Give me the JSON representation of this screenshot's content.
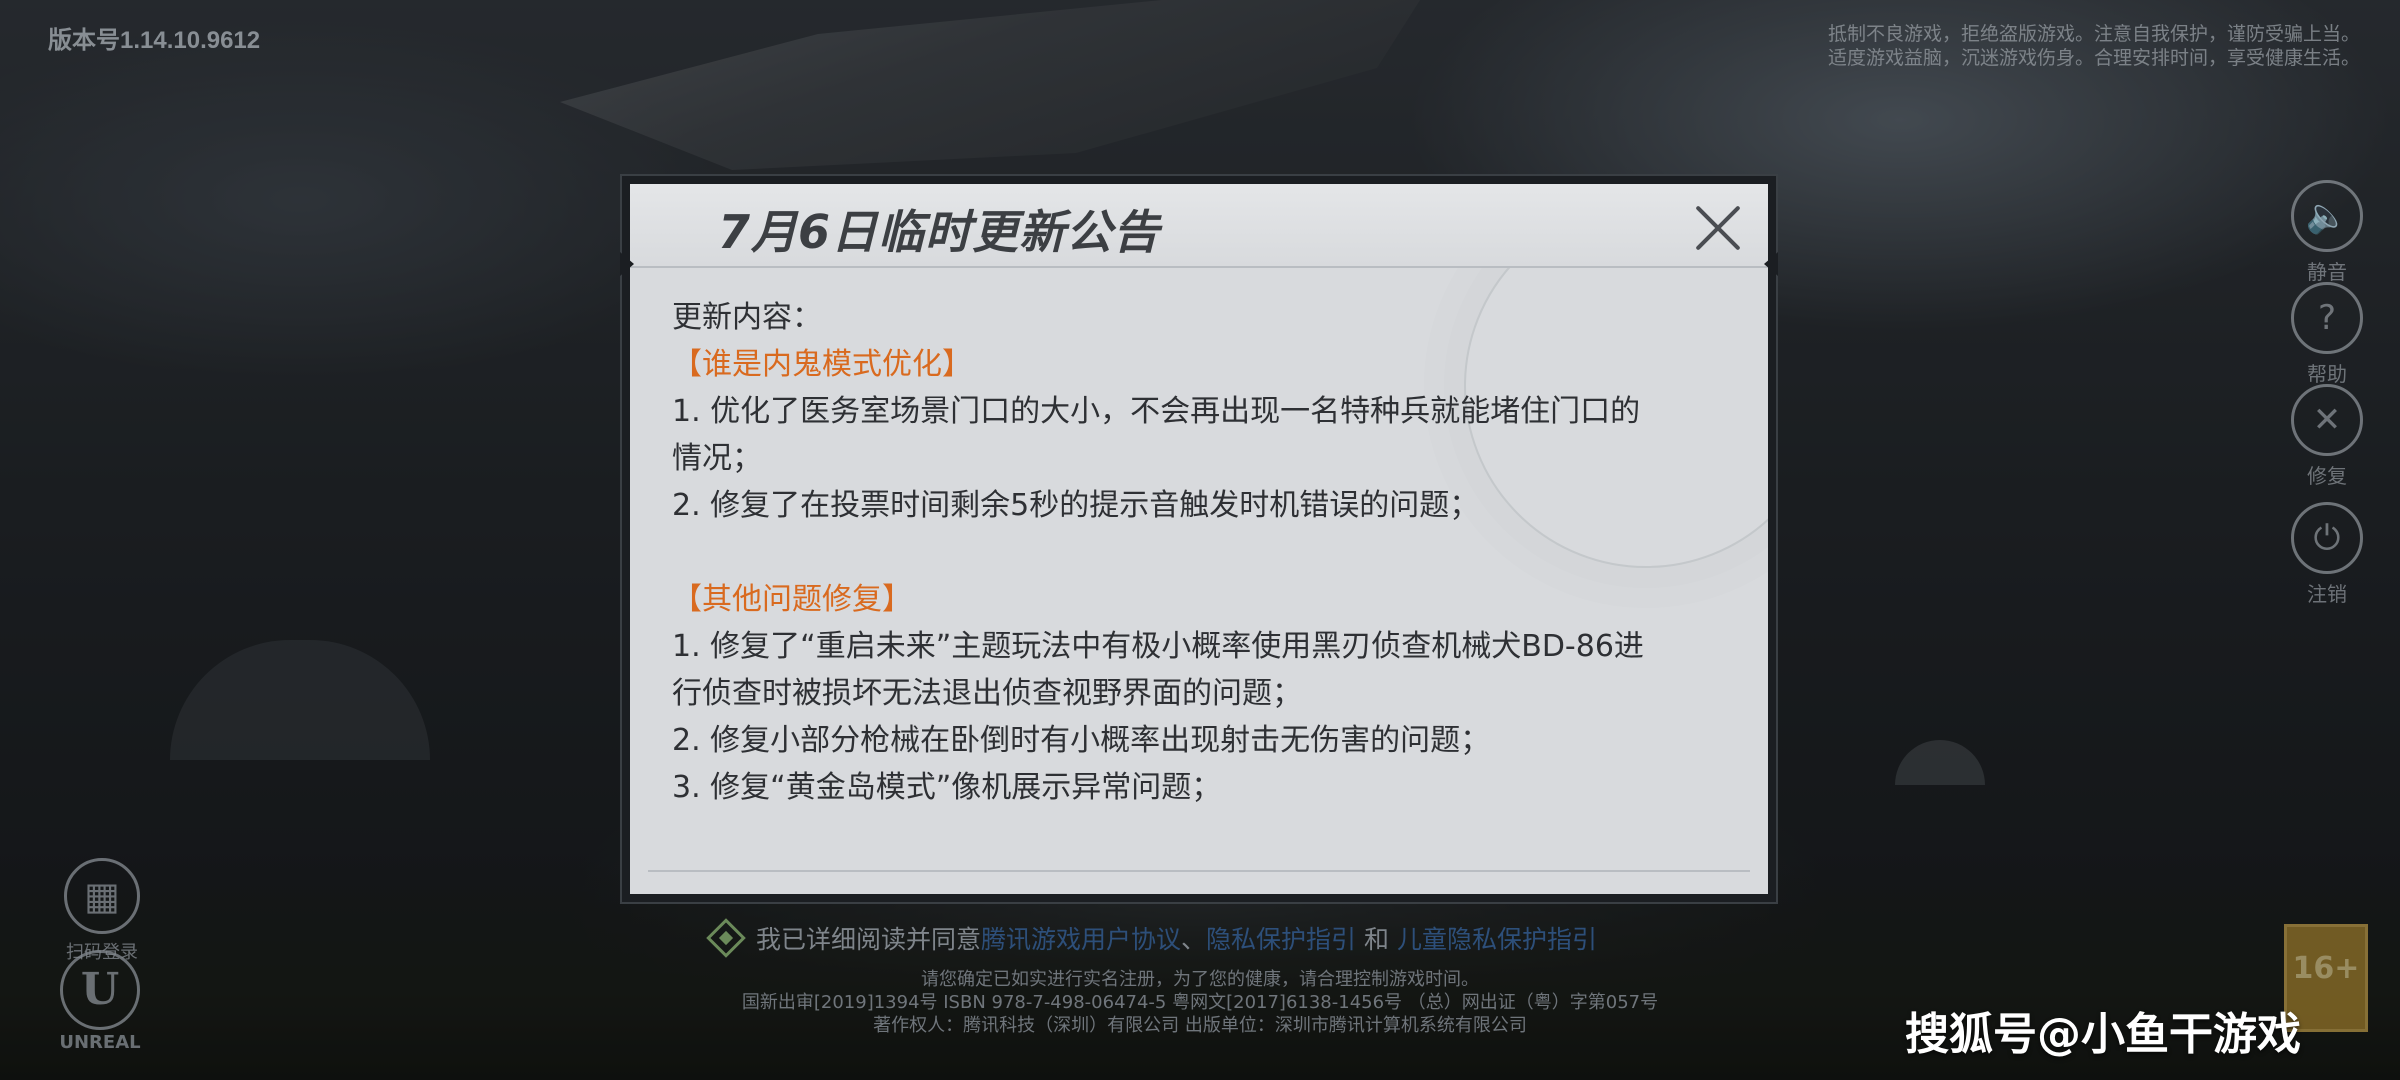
{
  "version": "版本号1.14.10.9612",
  "health_notice": [
    "抵制不良游戏，拒绝盗版游戏。注意自我保护，谨防受骗上当。",
    "适度游戏益脑，沉迷游戏伤身。合理安排时间，享受健康生活。"
  ],
  "side_buttons": {
    "mute": "静音",
    "help": "帮助",
    "repair": "修复",
    "logout": "注销"
  },
  "qr_login": "扫码登录",
  "unreal": "UNREAL",
  "dialog": {
    "title": "7月6日临时更新公告",
    "intro": "更新内容：",
    "section1": "【谁是内鬼模式优化】",
    "s1_lines": [
      "1. 优化了医务室场景门口的大小，不会再出现一名特种兵就能堵住门口的",
      "情况；",
      "2. 修复了在投票时间剩余5秒的提示音触发时机错误的问题；"
    ],
    "section2": "【其他问题修复】",
    "s2_lines": [
      "1. 修复了“重启未来”主题玩法中有极小概率使用黑刃侦查机械犬BD-86进",
      "行侦查时被损坏无法退出侦查视野界面的问题；",
      "2. 修复小部分枪械在卧倒时有小概率出现射击无伤害的问题；",
      "3. 修复“黄金岛模式”像机展示异常问题；"
    ]
  },
  "agreement": {
    "prefix": "我已详细阅读并同意",
    "link1": "腾讯游戏用户协议",
    "sep1": "、",
    "link2": "隐私保护指引",
    "sep2": "和",
    "link3": "儿童隐私保护指引"
  },
  "legal": [
    "请您确定已如实进行实名注册，为了您的健康，请合理控制游戏时间。",
    "国新出审[2019]1394号  ISBN 978-7-498-06474-5  粤网文[2017]6138-1456号 （总）网出证（粤）字第057号",
    "著作权人：腾讯科技（深圳）有限公司  出版单位：深圳市腾讯计算机系统有限公司"
  ],
  "age_rating": "16+",
  "watermark": "搜狐号@小鱼干游戏"
}
